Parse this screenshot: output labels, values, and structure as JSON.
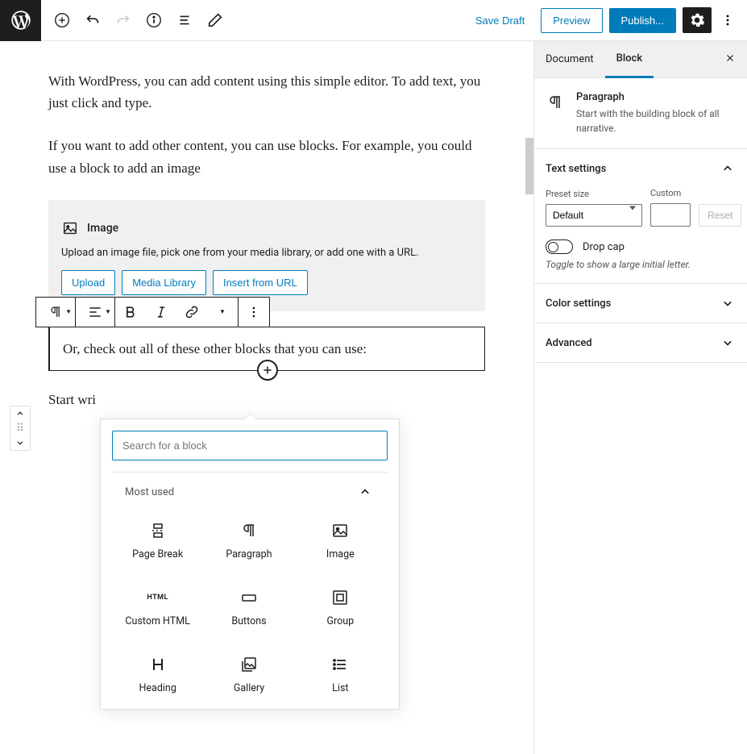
{
  "topbar": {
    "save_draft": "Save Draft",
    "preview": "Preview",
    "publish": "Publish..."
  },
  "content": {
    "para1": "With WordPress, you can add content using this simple editor. To add text, you just click and type.",
    "para2": "If you want to add other content, you can use blocks. For example, you could use a block to add an image",
    "selected": "Or, check out all of these other blocks that you can use:",
    "placeholder_next": "Start wri"
  },
  "image_block": {
    "title": "Image",
    "desc": "Upload an image file, pick one from your media library, or add one with a URL.",
    "upload": "Upload",
    "media_library": "Media Library",
    "insert_url": "Insert from URL"
  },
  "inserter": {
    "search_placeholder": "Search for a block",
    "category": "Most used",
    "items": [
      "Page Break",
      "Paragraph",
      "Image",
      "Custom HTML",
      "Buttons",
      "Group",
      "Heading",
      "Gallery",
      "List"
    ]
  },
  "sidebar": {
    "tab_document": "Document",
    "tab_block": "Block",
    "block_name": "Paragraph",
    "block_desc": "Start with the building block of all narrative.",
    "panel_text": "Text settings",
    "preset_label": "Preset size",
    "preset_value": "Default",
    "custom_label": "Custom",
    "reset": "Reset",
    "dropcap": "Drop cap",
    "dropcap_hint": "Toggle to show a large initial letter.",
    "panel_color": "Color settings",
    "panel_advanced": "Advanced"
  }
}
